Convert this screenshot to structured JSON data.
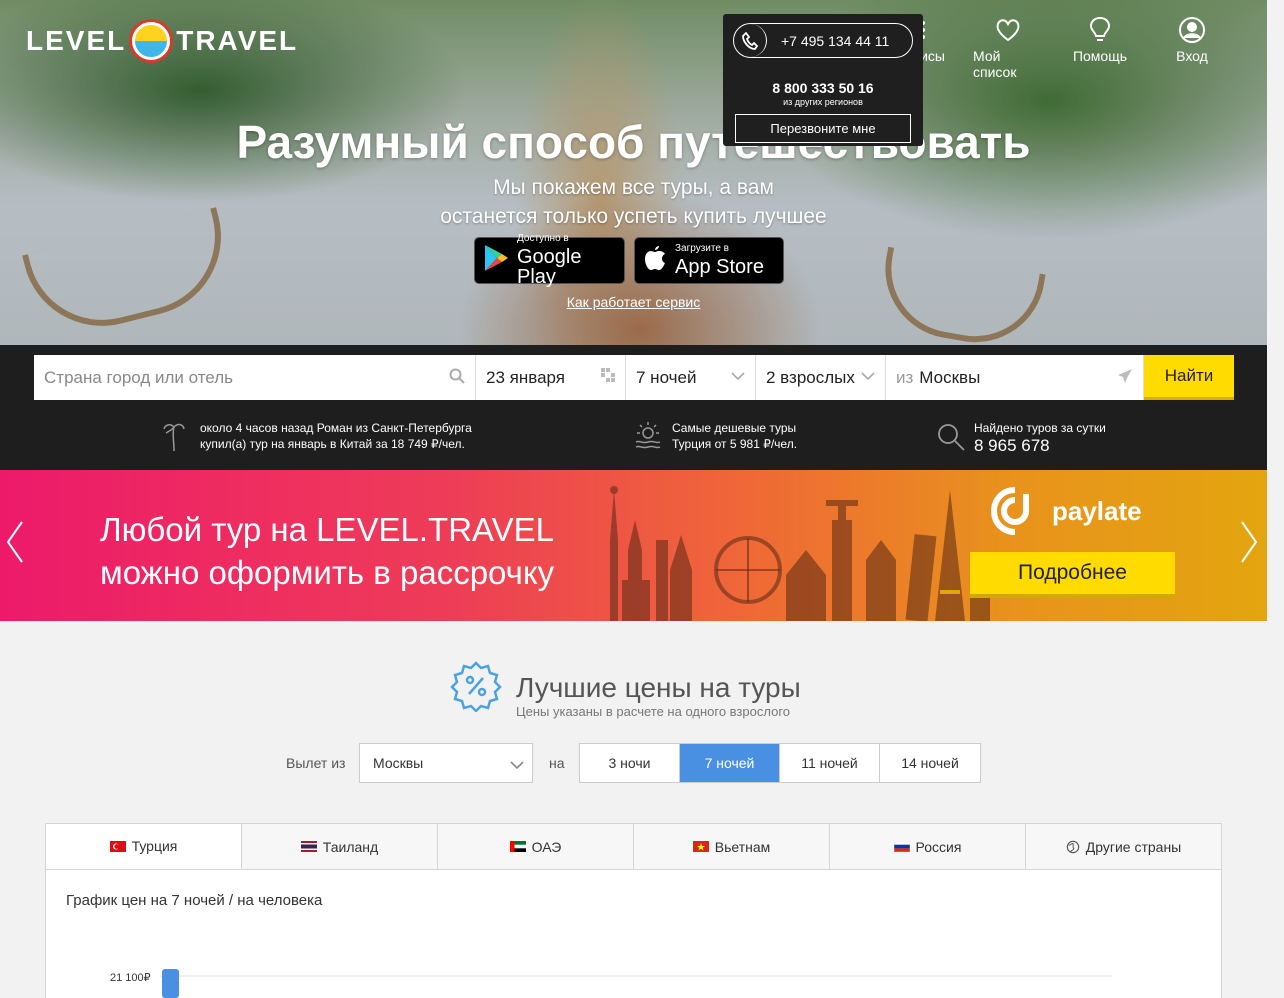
{
  "header": {
    "logo_left": "LEVEL",
    "logo_right": "TRAVEL",
    "nav": [
      {
        "label": "Сервисы",
        "icon": "grid-icon"
      },
      {
        "label": "Мой список",
        "icon": "heart-icon"
      },
      {
        "label": "Помощь",
        "icon": "lightbulb-icon"
      },
      {
        "label": "Вход",
        "icon": "user-icon"
      }
    ]
  },
  "phone_popup": {
    "phone": "+7 495 134 44 11",
    "alt_phone": "8 800 333 50 16",
    "alt_note": "из других регионов",
    "callback_label": "Перезвоните мне"
  },
  "hero": {
    "title": "Разумный способ путешествовать",
    "subtitle_1": "Мы покажем все туры, а вам",
    "subtitle_2": "останется только успеть купить лучшее",
    "google_small": "Доступно в",
    "google_big": "Google Play",
    "apple_small": "Загрузите в",
    "apple_big": "App Store",
    "how_link": "Как работает сервис"
  },
  "search": {
    "destination_placeholder": "Страна город или отель",
    "date": "23 января",
    "nights": "7 ночей",
    "guests": "2 взрослых",
    "from_prefix": "из",
    "from_city": "Москвы",
    "find_label": "Найти"
  },
  "info": {
    "recent_1": "около 4 часов назад Роман из Санкт-Петербурга",
    "recent_2": "купил(а) тур на январь в Китай за 18 749 ₽/чел.",
    "cheap_1": "Самые дешевые туры",
    "cheap_2": "Турция от 5 981 ₽/чел.",
    "found_1": "Найдено туров за сутки",
    "found_count": "8 965 678"
  },
  "banner": {
    "line_1": "Любой тур на LEVEL.TRAVEL",
    "line_2": "можно оформить в рассрочку",
    "brand": "paylate",
    "more_label": "Подробнее",
    "colors": {
      "start": "#ed1a6a",
      "end": "#e3a50f"
    }
  },
  "best_prices": {
    "title": "Лучшие цены на туры",
    "subtitle": "Цены указаны в расчете на одного взрослого",
    "depart_label": "Вылет из",
    "depart_value": "Москвы",
    "na_label": "на",
    "nights_options": [
      "3 ночи",
      "7 ночей",
      "11 ночей",
      "14 ночей"
    ],
    "active_nights": "7 ночей",
    "tabs": [
      {
        "label": "Турция",
        "flag": "tr"
      },
      {
        "label": "Таиланд",
        "flag": "th"
      },
      {
        "label": "ОАЭ",
        "flag": "ae"
      },
      {
        "label": "Вьетнам",
        "flag": "vn"
      },
      {
        "label": "Россия",
        "flag": "ru"
      },
      {
        "label": "Другие страны",
        "flag": "globe"
      }
    ],
    "chart_title": "График цен на 7 ночей / на человека",
    "chart_tick": "21 100₽",
    "accent": "#4a90e2"
  }
}
